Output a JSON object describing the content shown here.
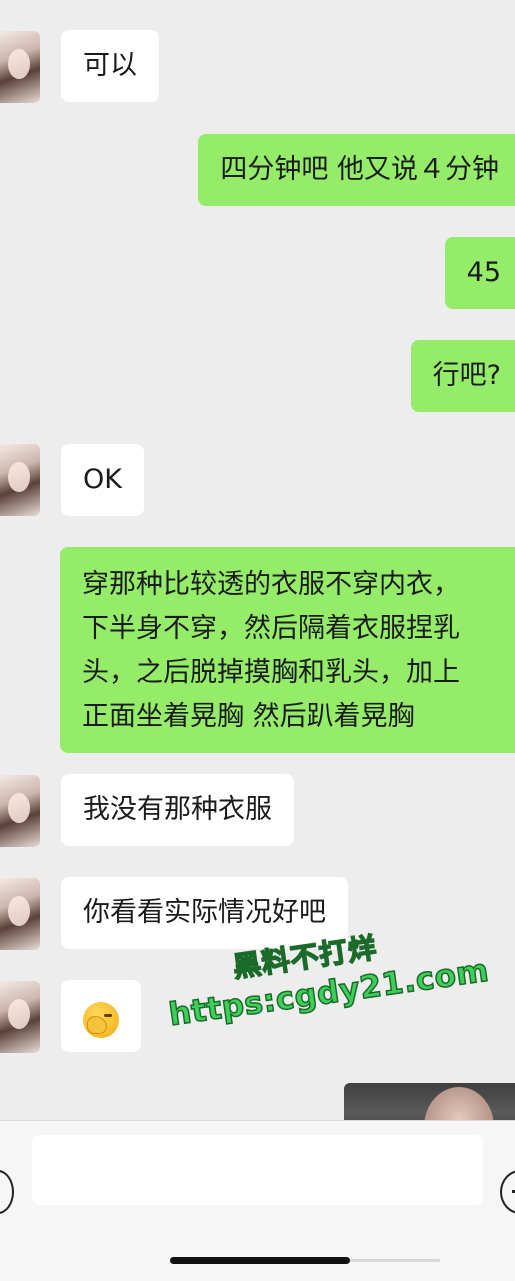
{
  "messages": [
    {
      "side": "in",
      "text": "可以"
    },
    {
      "side": "out",
      "text": "四分钟吧  他又说４分钟"
    },
    {
      "side": "out",
      "text": "45"
    },
    {
      "side": "out",
      "text": "行吧?"
    },
    {
      "side": "in",
      "text": "OK"
    },
    {
      "side": "out",
      "lines": [
        "穿那种比较透的衣服不穿内衣，",
        "下半身不穿，然后隔着衣服捏乳",
        "头，之后脱掉摸胸和乳头，加上",
        "正面坐着晃胸 然后趴着晃胸"
      ]
    },
    {
      "side": "in",
      "text": "我没有那种衣服"
    },
    {
      "side": "in",
      "text": "你看看实际情况好吧"
    },
    {
      "side": "in",
      "emoji": "face-with-hand-over-eyes-emoji"
    }
  ],
  "watermark": {
    "line1": "黑料不打烊",
    "line2": "https:cgdy21.com"
  },
  "input_bar": {
    "voice_icon": "voice-icon",
    "plus_icon": "plus-circle-icon",
    "input_value": ""
  },
  "colors": {
    "background": "#ededed",
    "incoming_bubble": "#ffffff",
    "outgoing_bubble": "#95ec69",
    "watermark_text": "#3ecf58"
  }
}
